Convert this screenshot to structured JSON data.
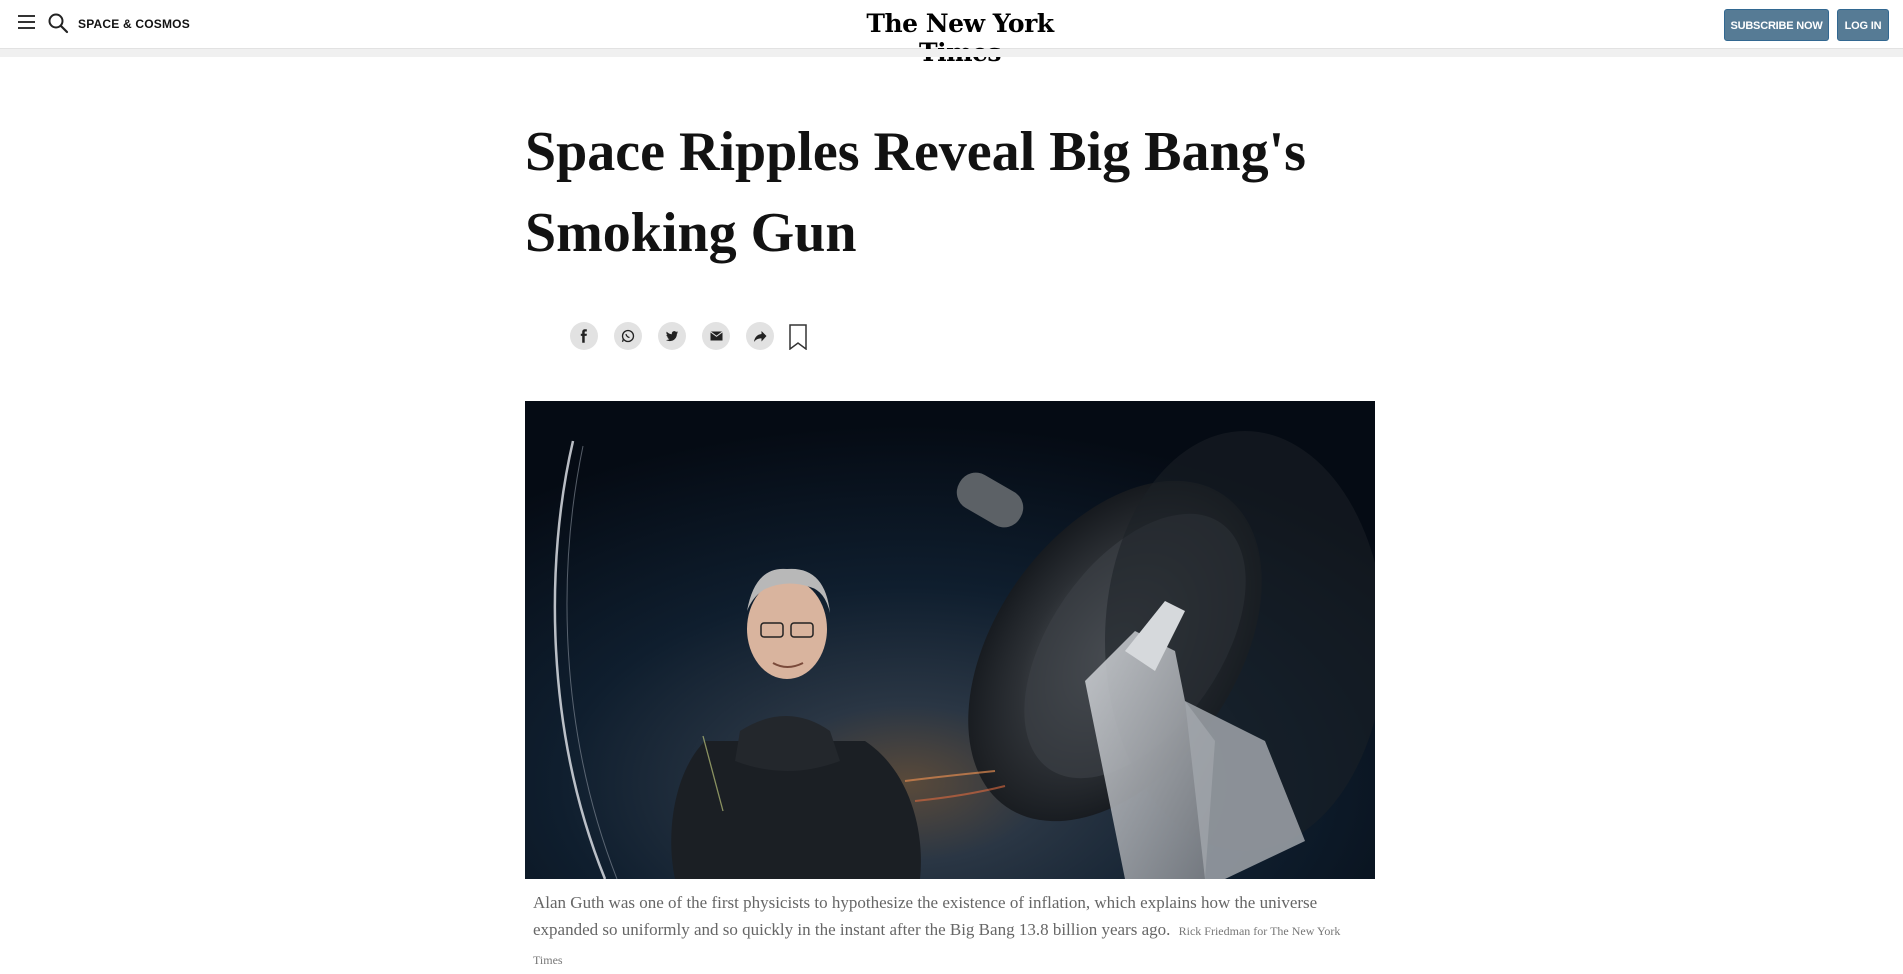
{
  "header": {
    "section": "SPACE & COSMOS",
    "logo": "The New York Times",
    "subscribe_label": "SUBSCRIBE NOW",
    "login_label": "LOG IN",
    "icons": [
      "menu-icon",
      "search-icon"
    ],
    "button_color": "#567b95"
  },
  "article": {
    "headline": "Space Ripples Reveal Big Bang's Smoking Gun",
    "share": [
      "facebook-icon",
      "whatsapp-icon",
      "twitter-icon",
      "email-icon",
      "share-icon",
      "bookmark-icon"
    ],
    "image": {
      "caption": "Alan Guth was one of the first physicists to hypothesize the existence of inflation, which explains how the universe expanded so uniformly and so quickly in the instant after the Big Bang 13.8 billion years ago.",
      "credit": "Rick Friedman for The New York Times"
    }
  }
}
